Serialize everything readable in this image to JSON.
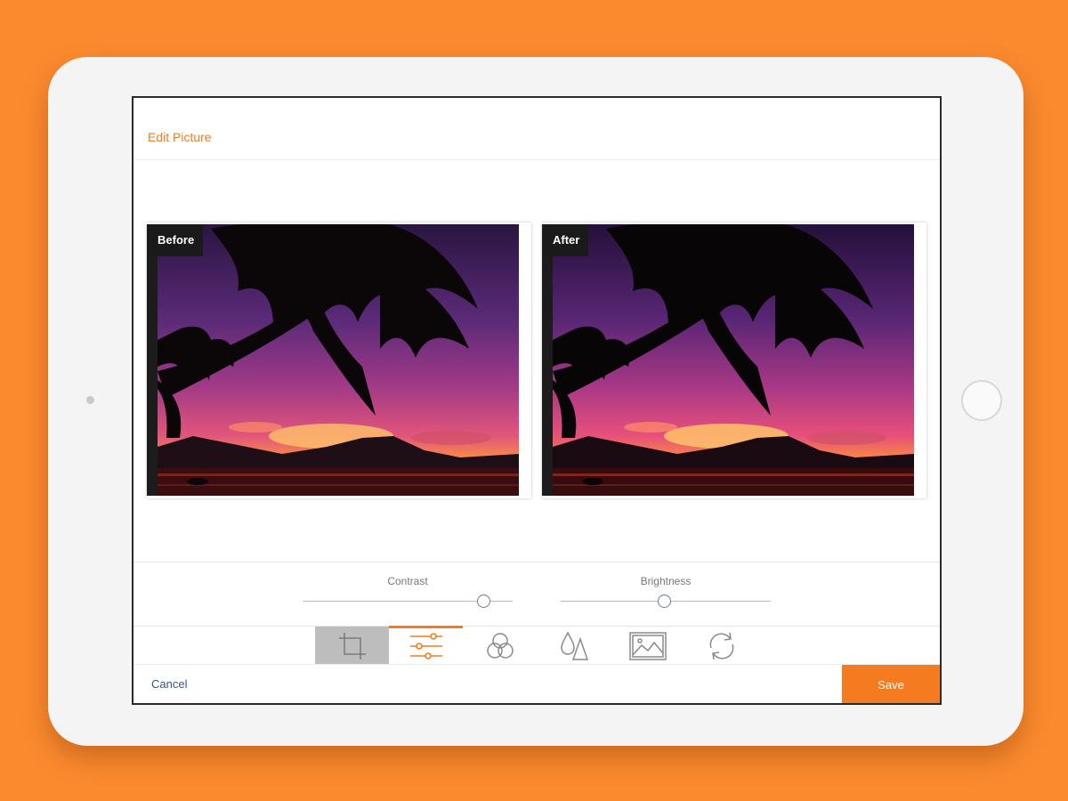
{
  "dialog": {
    "title": "Edit Picture"
  },
  "preview": {
    "before_label": "Before",
    "after_label": "After"
  },
  "adjustments": {
    "contrast": {
      "label": "Contrast",
      "value_fraction": 0.86
    },
    "brightness": {
      "label": "Brightness",
      "value_fraction": 0.49
    }
  },
  "tools": [
    {
      "name": "crop",
      "icon": "crop-icon",
      "state": "pressed"
    },
    {
      "name": "adjust",
      "icon": "sliders-icon",
      "state": "selected"
    },
    {
      "name": "filters",
      "icon": "color-circles-icon",
      "state": "normal"
    },
    {
      "name": "sharpen",
      "icon": "drops-icon",
      "state": "normal"
    },
    {
      "name": "image",
      "icon": "image-icon",
      "state": "normal"
    },
    {
      "name": "rotate",
      "icon": "rotate-icon",
      "state": "normal"
    }
  ],
  "footer": {
    "cancel_label": "Cancel",
    "save_label": "Save"
  },
  "colors": {
    "background": "#FB8A2E",
    "accent": "#F47B20",
    "link": "#3B5585"
  }
}
